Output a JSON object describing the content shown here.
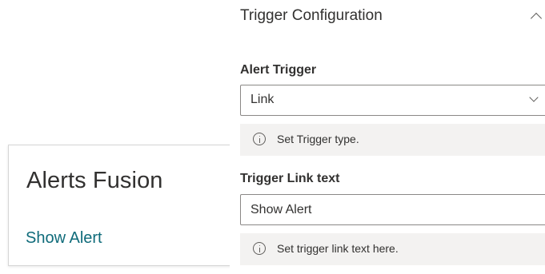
{
  "webpart": {
    "title": "Alerts Fusion",
    "link_text": "Show Alert"
  },
  "property_pane": {
    "group_title": "Trigger Configuration",
    "group_icon": "chevron-up-icon",
    "alert_trigger": {
      "label": "Alert Trigger",
      "selected_value": "Link",
      "icon": "chevron-down-icon",
      "help_icon": "info-icon",
      "help_text": "Set Trigger type."
    },
    "trigger_link_text": {
      "label": "Trigger Link text",
      "value": "Show Alert",
      "help_icon": "info-icon",
      "help_text": "Set trigger link text here."
    }
  },
  "colors": {
    "link": "#0f6b7a",
    "text": "#323130",
    "border": "#8a8886",
    "help_background": "#f3f2f1",
    "card_border": "#d6d6d6"
  }
}
